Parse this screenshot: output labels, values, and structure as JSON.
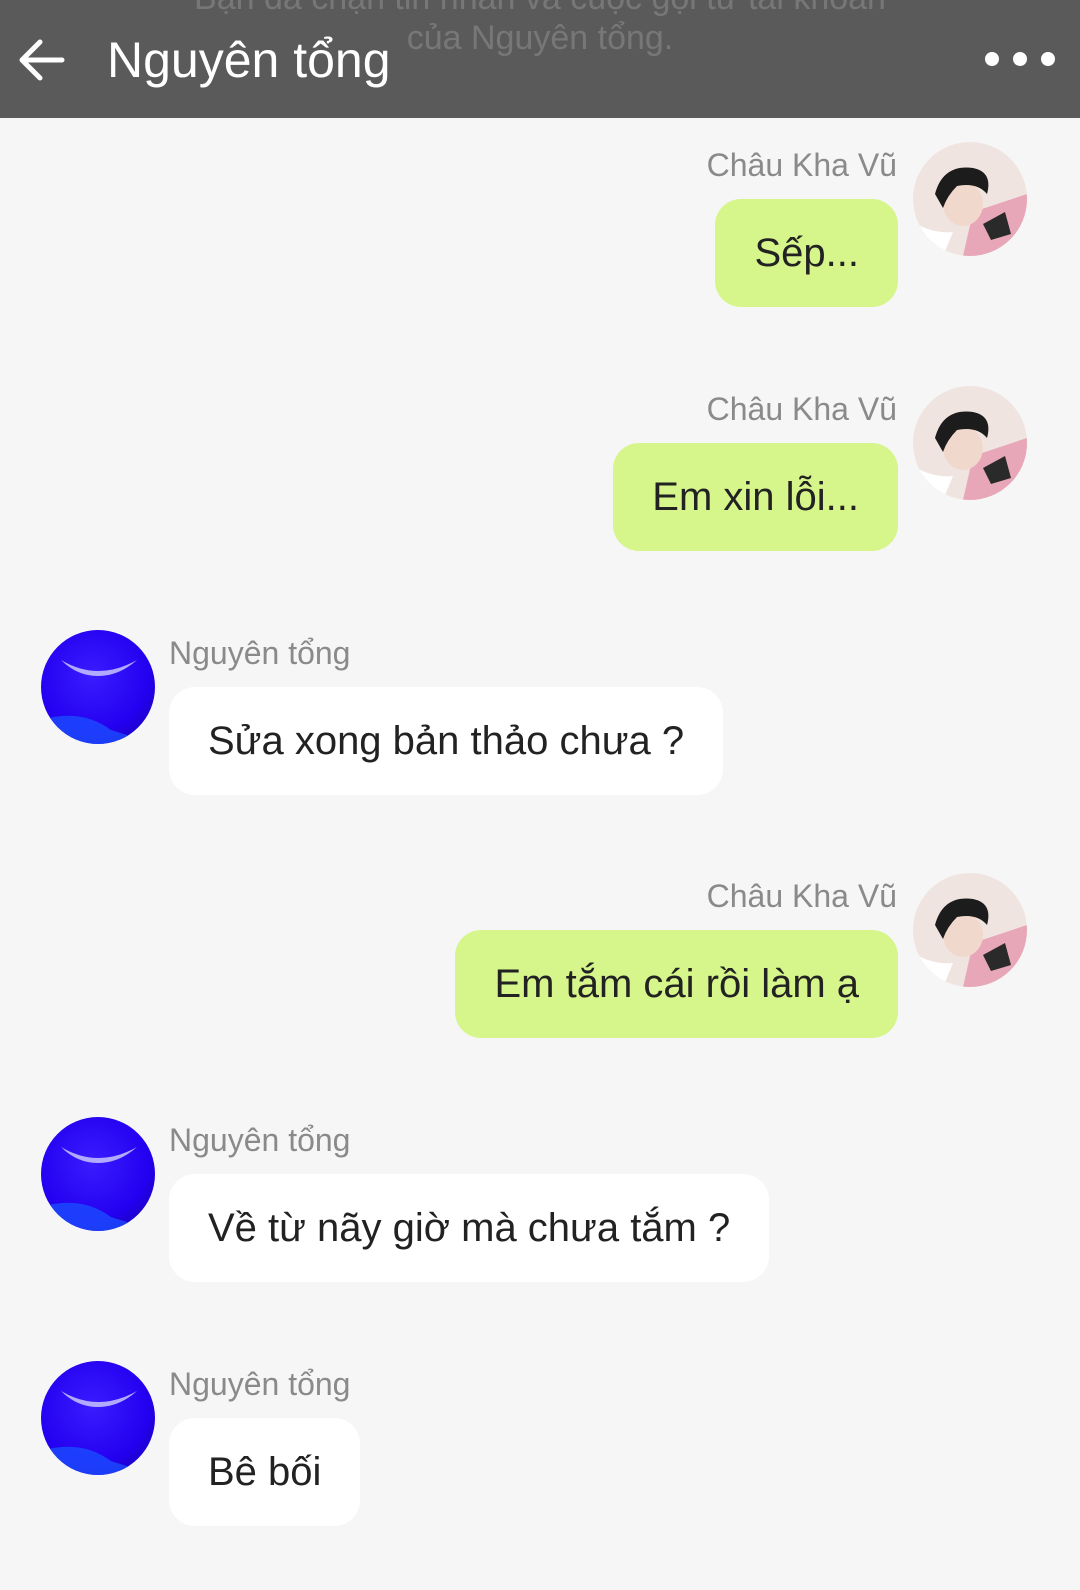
{
  "header": {
    "title": "Nguyên tổng",
    "banner_line1": "Bạn đã chặn tin nhắn và cuộc gọi từ tài khoản",
    "banner_line2": "của Nguyên tổng."
  },
  "icons": {
    "back": "arrow-left-icon",
    "more": "more-horizontal-icon"
  },
  "colors": {
    "header_bg": "#5a5a5a",
    "outgoing_bubble": "#d6f58b",
    "incoming_bubble": "#ffffff",
    "chat_bg": "#f6f6f6",
    "sender_name": "#8a8a8a"
  },
  "messages": [
    {
      "direction": "outgoing",
      "sender": "Châu Kha Vũ",
      "text": "Sếp..."
    },
    {
      "direction": "outgoing",
      "sender": "Châu Kha Vũ",
      "text": "Em xin lỗi..."
    },
    {
      "direction": "incoming",
      "sender": "Nguyên tổng",
      "text": "Sửa xong bản thảo chưa ?"
    },
    {
      "direction": "outgoing",
      "sender": "Châu Kha Vũ",
      "text": "Em tắm cái rồi làm ạ"
    },
    {
      "direction": "incoming",
      "sender": "Nguyên tổng",
      "text": "Về từ nãy giờ mà chưa tắm ?"
    },
    {
      "direction": "incoming",
      "sender": "Nguyên tổng",
      "text": "Bê bối"
    }
  ]
}
